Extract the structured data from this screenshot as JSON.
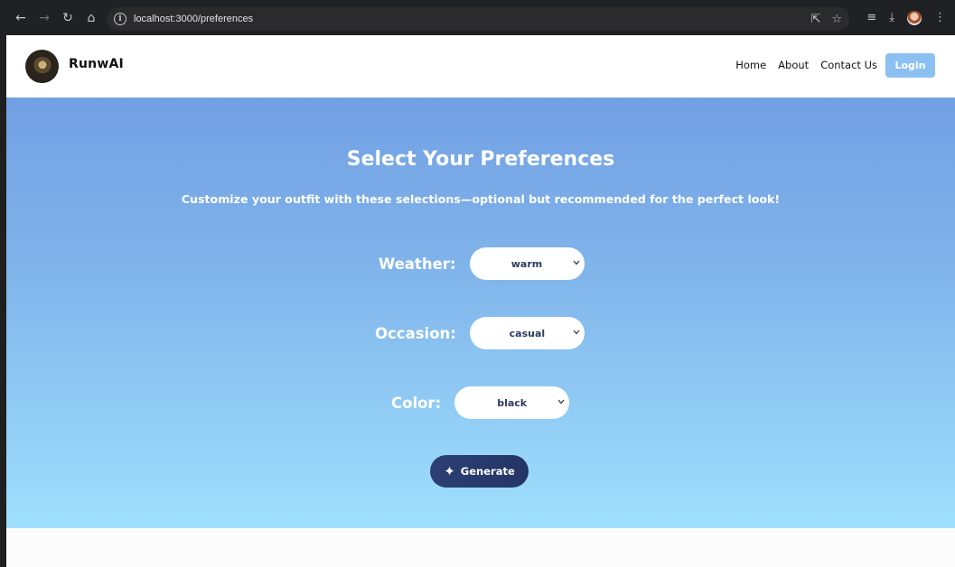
{
  "browser": {
    "url": "localhost:3000/preferences",
    "back_icon": "←",
    "forward_icon": "→",
    "reload_icon": "↻",
    "home_icon": "⌂",
    "info_icon": "i",
    "install_icon": "⇱",
    "star_icon": "☆",
    "reading_list_icon": "≡",
    "download_icon": "⤓",
    "menu_icon": "⋮"
  },
  "header": {
    "brand": "RunwAI",
    "nav": [
      "Home",
      "About",
      "Contact Us"
    ],
    "login_label": "Login"
  },
  "hero": {
    "title": "Select Your Preferences",
    "subtitle": "Customize your outfit with these selections—optional but recommended for the perfect look!"
  },
  "preferences": {
    "weather_label": "Weather:",
    "weather_value": "warm",
    "occasion_label": "Occasion:",
    "occasion_value": "casual",
    "color_label": "Color:",
    "color_value": "black"
  },
  "generate": {
    "label": "Generate",
    "icon": "✦"
  },
  "colors": {
    "hero_top": "#72a0e4",
    "hero_bottom": "#9fe0fd",
    "generate_bg": "#2c4076",
    "login_bg": "#8cc0f2"
  }
}
